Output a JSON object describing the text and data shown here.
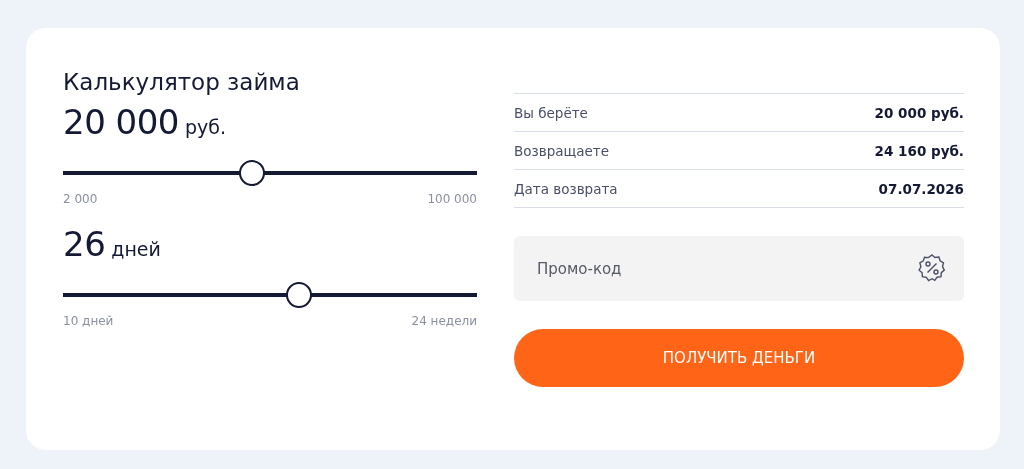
{
  "title": "Калькулятор займа",
  "sliders": [
    {
      "value": "20 000",
      "unit": "руб.",
      "level": 0.457,
      "min_label": "2 000",
      "max_label": "100 000"
    },
    {
      "value": "26",
      "unit": "дней",
      "level": 0.57,
      "min_label": "10 дней",
      "max_label": "24 недели"
    }
  ],
  "summary": [
    {
      "label": "Вы берёте",
      "value": "20 000 руб."
    },
    {
      "label": "Возвращаете",
      "value": "24 160 руб."
    },
    {
      "label": "Дата возврата",
      "value": "07.07.2026"
    }
  ],
  "promo": {
    "placeholder": "Промо-код"
  },
  "submit": {
    "label": "ПОЛУЧИТЬ ДЕНЬГИ"
  }
}
